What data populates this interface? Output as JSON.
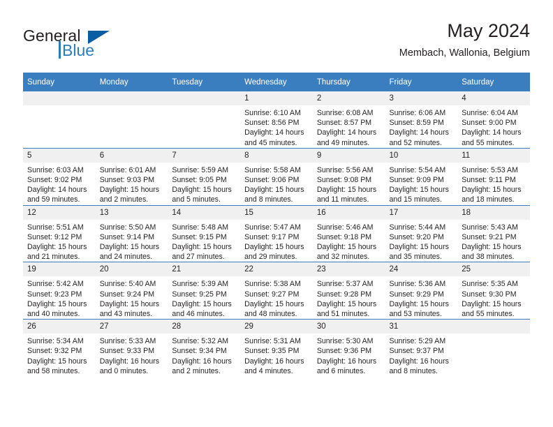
{
  "brand": {
    "word_general": "General",
    "word_blue": "Blue",
    "mark_icon": "triangle-logo-icon",
    "accent_color": "#2b7bc1",
    "mark_color": "#0a5ca3"
  },
  "header": {
    "title": "May 2024",
    "subtitle": "Membach, Wallonia, Belgium"
  },
  "calendar": {
    "header_bg": "#3b7ebf",
    "daynum_bg": "#f0f0f0",
    "weekday_headers": [
      "Sunday",
      "Monday",
      "Tuesday",
      "Wednesday",
      "Thursday",
      "Friday",
      "Saturday"
    ],
    "weeks": [
      [
        {
          "day": "",
          "empty": true,
          "lines": []
        },
        {
          "day": "",
          "empty": true,
          "lines": []
        },
        {
          "day": "",
          "empty": true,
          "lines": []
        },
        {
          "day": "1",
          "empty": false,
          "lines": [
            "Sunrise: 6:10 AM",
            "Sunset: 8:56 PM",
            "Daylight: 14 hours",
            "and 45 minutes."
          ]
        },
        {
          "day": "2",
          "empty": false,
          "lines": [
            "Sunrise: 6:08 AM",
            "Sunset: 8:57 PM",
            "Daylight: 14 hours",
            "and 49 minutes."
          ]
        },
        {
          "day": "3",
          "empty": false,
          "lines": [
            "Sunrise: 6:06 AM",
            "Sunset: 8:59 PM",
            "Daylight: 14 hours",
            "and 52 minutes."
          ]
        },
        {
          "day": "4",
          "empty": false,
          "lines": [
            "Sunrise: 6:04 AM",
            "Sunset: 9:00 PM",
            "Daylight: 14 hours",
            "and 55 minutes."
          ]
        }
      ],
      [
        {
          "day": "5",
          "empty": false,
          "lines": [
            "Sunrise: 6:03 AM",
            "Sunset: 9:02 PM",
            "Daylight: 14 hours",
            "and 59 minutes."
          ]
        },
        {
          "day": "6",
          "empty": false,
          "lines": [
            "Sunrise: 6:01 AM",
            "Sunset: 9:03 PM",
            "Daylight: 15 hours",
            "and 2 minutes."
          ]
        },
        {
          "day": "7",
          "empty": false,
          "lines": [
            "Sunrise: 5:59 AM",
            "Sunset: 9:05 PM",
            "Daylight: 15 hours",
            "and 5 minutes."
          ]
        },
        {
          "day": "8",
          "empty": false,
          "lines": [
            "Sunrise: 5:58 AM",
            "Sunset: 9:06 PM",
            "Daylight: 15 hours",
            "and 8 minutes."
          ]
        },
        {
          "day": "9",
          "empty": false,
          "lines": [
            "Sunrise: 5:56 AM",
            "Sunset: 9:08 PM",
            "Daylight: 15 hours",
            "and 11 minutes."
          ]
        },
        {
          "day": "10",
          "empty": false,
          "lines": [
            "Sunrise: 5:54 AM",
            "Sunset: 9:09 PM",
            "Daylight: 15 hours",
            "and 15 minutes."
          ]
        },
        {
          "day": "11",
          "empty": false,
          "lines": [
            "Sunrise: 5:53 AM",
            "Sunset: 9:11 PM",
            "Daylight: 15 hours",
            "and 18 minutes."
          ]
        }
      ],
      [
        {
          "day": "12",
          "empty": false,
          "lines": [
            "Sunrise: 5:51 AM",
            "Sunset: 9:12 PM",
            "Daylight: 15 hours",
            "and 21 minutes."
          ]
        },
        {
          "day": "13",
          "empty": false,
          "lines": [
            "Sunrise: 5:50 AM",
            "Sunset: 9:14 PM",
            "Daylight: 15 hours",
            "and 24 minutes."
          ]
        },
        {
          "day": "14",
          "empty": false,
          "lines": [
            "Sunrise: 5:48 AM",
            "Sunset: 9:15 PM",
            "Daylight: 15 hours",
            "and 27 minutes."
          ]
        },
        {
          "day": "15",
          "empty": false,
          "lines": [
            "Sunrise: 5:47 AM",
            "Sunset: 9:17 PM",
            "Daylight: 15 hours",
            "and 29 minutes."
          ]
        },
        {
          "day": "16",
          "empty": false,
          "lines": [
            "Sunrise: 5:46 AM",
            "Sunset: 9:18 PM",
            "Daylight: 15 hours",
            "and 32 minutes."
          ]
        },
        {
          "day": "17",
          "empty": false,
          "lines": [
            "Sunrise: 5:44 AM",
            "Sunset: 9:20 PM",
            "Daylight: 15 hours",
            "and 35 minutes."
          ]
        },
        {
          "day": "18",
          "empty": false,
          "lines": [
            "Sunrise: 5:43 AM",
            "Sunset: 9:21 PM",
            "Daylight: 15 hours",
            "and 38 minutes."
          ]
        }
      ],
      [
        {
          "day": "19",
          "empty": false,
          "lines": [
            "Sunrise: 5:42 AM",
            "Sunset: 9:23 PM",
            "Daylight: 15 hours",
            "and 40 minutes."
          ]
        },
        {
          "day": "20",
          "empty": false,
          "lines": [
            "Sunrise: 5:40 AM",
            "Sunset: 9:24 PM",
            "Daylight: 15 hours",
            "and 43 minutes."
          ]
        },
        {
          "day": "21",
          "empty": false,
          "lines": [
            "Sunrise: 5:39 AM",
            "Sunset: 9:25 PM",
            "Daylight: 15 hours",
            "and 46 minutes."
          ]
        },
        {
          "day": "22",
          "empty": false,
          "lines": [
            "Sunrise: 5:38 AM",
            "Sunset: 9:27 PM",
            "Daylight: 15 hours",
            "and 48 minutes."
          ]
        },
        {
          "day": "23",
          "empty": false,
          "lines": [
            "Sunrise: 5:37 AM",
            "Sunset: 9:28 PM",
            "Daylight: 15 hours",
            "and 51 minutes."
          ]
        },
        {
          "day": "24",
          "empty": false,
          "lines": [
            "Sunrise: 5:36 AM",
            "Sunset: 9:29 PM",
            "Daylight: 15 hours",
            "and 53 minutes."
          ]
        },
        {
          "day": "25",
          "empty": false,
          "lines": [
            "Sunrise: 5:35 AM",
            "Sunset: 9:30 PM",
            "Daylight: 15 hours",
            "and 55 minutes."
          ]
        }
      ],
      [
        {
          "day": "26",
          "empty": false,
          "lines": [
            "Sunrise: 5:34 AM",
            "Sunset: 9:32 PM",
            "Daylight: 15 hours",
            "and 58 minutes."
          ]
        },
        {
          "day": "27",
          "empty": false,
          "lines": [
            "Sunrise: 5:33 AM",
            "Sunset: 9:33 PM",
            "Daylight: 16 hours",
            "and 0 minutes."
          ]
        },
        {
          "day": "28",
          "empty": false,
          "lines": [
            "Sunrise: 5:32 AM",
            "Sunset: 9:34 PM",
            "Daylight: 16 hours",
            "and 2 minutes."
          ]
        },
        {
          "day": "29",
          "empty": false,
          "lines": [
            "Sunrise: 5:31 AM",
            "Sunset: 9:35 PM",
            "Daylight: 16 hours",
            "and 4 minutes."
          ]
        },
        {
          "day": "30",
          "empty": false,
          "lines": [
            "Sunrise: 5:30 AM",
            "Sunset: 9:36 PM",
            "Daylight: 16 hours",
            "and 6 minutes."
          ]
        },
        {
          "day": "31",
          "empty": false,
          "lines": [
            "Sunrise: 5:29 AM",
            "Sunset: 9:37 PM",
            "Daylight: 16 hours",
            "and 8 minutes."
          ]
        },
        {
          "day": "",
          "empty": true,
          "lines": []
        }
      ]
    ]
  }
}
